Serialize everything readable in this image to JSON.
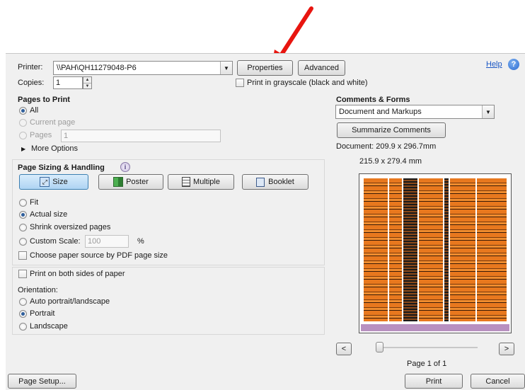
{
  "printer": {
    "label": "Printer:",
    "value": "\\\\PAH\\QH11279048-P6",
    "properties": "Properties",
    "advanced": "Advanced",
    "help": "Help"
  },
  "copies": {
    "label": "Copies:",
    "value": "1"
  },
  "grayscale": {
    "label": "Print in grayscale (black and white)"
  },
  "pages_to_print": {
    "title": "Pages to Print",
    "all": "All",
    "current": "Current page",
    "pages": "Pages",
    "pages_value": "1",
    "more": "More Options"
  },
  "sizing": {
    "title": "Page Sizing & Handling",
    "buttons": {
      "size": "Size",
      "poster": "Poster",
      "multiple": "Multiple",
      "booklet": "Booklet"
    },
    "fit": "Fit",
    "actual": "Actual size",
    "shrink": "Shrink oversized pages",
    "custom": "Custom Scale:",
    "custom_value": "100",
    "percent": "%",
    "paper_source": "Choose paper source by PDF page size"
  },
  "duplex": {
    "label": "Print on both sides of paper"
  },
  "orientation": {
    "title": "Orientation:",
    "auto": "Auto portrait/landscape",
    "portrait": "Portrait",
    "landscape": "Landscape"
  },
  "comments": {
    "title": "Comments & Forms",
    "value": "Document and Markups",
    "summarize": "Summarize Comments"
  },
  "preview": {
    "document": "Document: 209.9 x 296.7mm",
    "paper": "215.9 x 279.4 mm",
    "page_of": "Page 1 of 1",
    "prev": "<",
    "next": ">"
  },
  "footer": {
    "page_setup": "Page Setup...",
    "print": "Print",
    "cancel": "Cancel"
  },
  "colors": {
    "arrow": "#e8150f",
    "accent": "#2f5f9c",
    "preview_orange": "#e8781e"
  },
  "icons": {
    "arrow": "red-arrow-annotation",
    "help": "help-icon",
    "info": "info-icon"
  }
}
